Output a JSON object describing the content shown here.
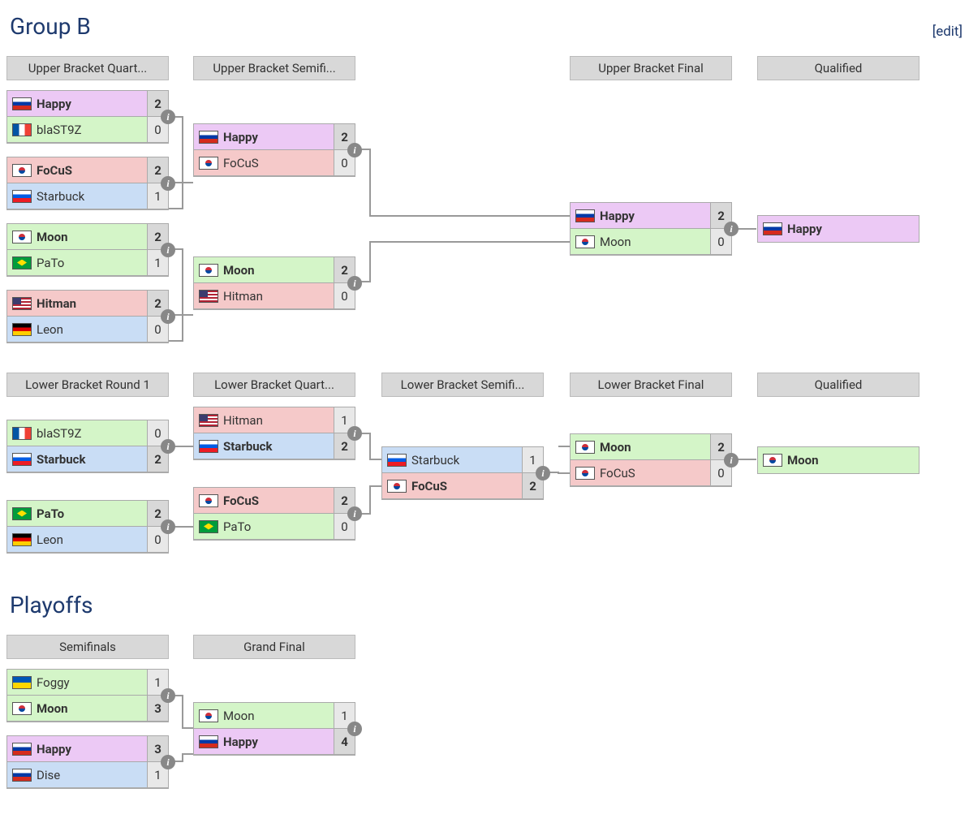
{
  "groupB": {
    "title": "Group B",
    "edit": "[edit]",
    "upper": {
      "rounds": [
        "Upper Bracket Quart...",
        "Upper Bracket Semifi...",
        "Upper Bracket Final",
        "Qualified"
      ],
      "matches": [
        {
          "id": "uq1",
          "slots": [
            {
              "name": "Happy",
              "flag": "ru",
              "score": "2",
              "color": "purple",
              "win": true
            },
            {
              "name": "blaST9Z",
              "flag": "fr",
              "score": "0",
              "color": "green"
            }
          ]
        },
        {
          "id": "uq2",
          "slots": [
            {
              "name": "FoCuS",
              "flag": "kr",
              "score": "2",
              "color": "red",
              "win": true
            },
            {
              "name": "Starbuck",
              "flag": "si",
              "score": "1",
              "color": "blue"
            }
          ]
        },
        {
          "id": "uq3",
          "slots": [
            {
              "name": "Moon",
              "flag": "kr",
              "score": "2",
              "color": "green",
              "win": true
            },
            {
              "name": "PaTo",
              "flag": "br",
              "score": "1",
              "color": "green"
            }
          ]
        },
        {
          "id": "uq4",
          "slots": [
            {
              "name": "Hitman",
              "flag": "us",
              "score": "2",
              "color": "red",
              "win": true
            },
            {
              "name": "Leon",
              "flag": "de",
              "score": "0",
              "color": "blue"
            }
          ]
        },
        {
          "id": "us1",
          "slots": [
            {
              "name": "Happy",
              "flag": "ru",
              "score": "2",
              "color": "purple",
              "win": true
            },
            {
              "name": "FoCuS",
              "flag": "kr",
              "score": "0",
              "color": "red"
            }
          ]
        },
        {
          "id": "us2",
          "slots": [
            {
              "name": "Moon",
              "flag": "kr",
              "score": "2",
              "color": "green",
              "win": true
            },
            {
              "name": "Hitman",
              "flag": "us",
              "score": "0",
              "color": "red"
            }
          ]
        },
        {
          "id": "uf",
          "slots": [
            {
              "name": "Happy",
              "flag": "ru",
              "score": "2",
              "color": "purple",
              "win": true
            },
            {
              "name": "Moon",
              "flag": "kr",
              "score": "0",
              "color": "green"
            }
          ]
        },
        {
          "id": "uqal",
          "slots": [
            {
              "name": "Happy",
              "flag": "ru",
              "color": "purple",
              "win": true
            }
          ],
          "noscore": true,
          "nobadge": true
        }
      ]
    },
    "lower": {
      "rounds": [
        "Lower Bracket Round 1",
        "Lower Bracket Quart...",
        "Lower Bracket Semifi...",
        "Lower Bracket Final",
        "Qualified"
      ],
      "matches": [
        {
          "id": "lr1a",
          "slots": [
            {
              "name": "blaST9Z",
              "flag": "fr",
              "score": "0",
              "color": "green"
            },
            {
              "name": "Starbuck",
              "flag": "si",
              "score": "2",
              "color": "blue",
              "win": true
            }
          ]
        },
        {
          "id": "lr1b",
          "slots": [
            {
              "name": "PaTo",
              "flag": "br",
              "score": "2",
              "color": "green",
              "win": true
            },
            {
              "name": "Leon",
              "flag": "de",
              "score": "0",
              "color": "blue"
            }
          ]
        },
        {
          "id": "lq1",
          "slots": [
            {
              "name": "Hitman",
              "flag": "us",
              "score": "1",
              "color": "red"
            },
            {
              "name": "Starbuck",
              "flag": "si",
              "score": "2",
              "color": "blue",
              "win": true
            }
          ]
        },
        {
          "id": "lq2",
          "slots": [
            {
              "name": "FoCuS",
              "flag": "kr",
              "score": "2",
              "color": "red",
              "win": true
            },
            {
              "name": "PaTo",
              "flag": "br",
              "score": "0",
              "color": "green"
            }
          ]
        },
        {
          "id": "ls",
          "slots": [
            {
              "name": "Starbuck",
              "flag": "si",
              "score": "1",
              "color": "blue"
            },
            {
              "name": "FoCuS",
              "flag": "kr",
              "score": "2",
              "color": "red",
              "win": true
            }
          ]
        },
        {
          "id": "lf",
          "slots": [
            {
              "name": "Moon",
              "flag": "kr",
              "score": "2",
              "color": "green",
              "win": true
            },
            {
              "name": "FoCuS",
              "flag": "kr",
              "score": "0",
              "color": "red"
            }
          ]
        },
        {
          "id": "lqal",
          "slots": [
            {
              "name": "Moon",
              "flag": "kr",
              "color": "green",
              "win": true
            }
          ],
          "noscore": true,
          "nobadge": true
        }
      ]
    }
  },
  "playoffs": {
    "title": "Playoffs",
    "rounds": [
      "Semifinals",
      "Grand Final"
    ],
    "matches": [
      {
        "id": "sf1",
        "slots": [
          {
            "name": "Foggy",
            "flag": "ua",
            "score": "1",
            "color": "green"
          },
          {
            "name": "Moon",
            "flag": "kr",
            "score": "3",
            "color": "green",
            "win": true
          }
        ]
      },
      {
        "id": "sf2",
        "slots": [
          {
            "name": "Happy",
            "flag": "ru",
            "score": "3",
            "color": "purple",
            "win": true
          },
          {
            "name": "Dise",
            "flag": "ru",
            "score": "1",
            "color": "blue"
          }
        ]
      },
      {
        "id": "gf",
        "slots": [
          {
            "name": "Moon",
            "flag": "kr",
            "score": "1",
            "color": "green"
          },
          {
            "name": "Happy",
            "flag": "ru",
            "score": "4",
            "color": "purple",
            "win": true
          }
        ]
      }
    ]
  }
}
